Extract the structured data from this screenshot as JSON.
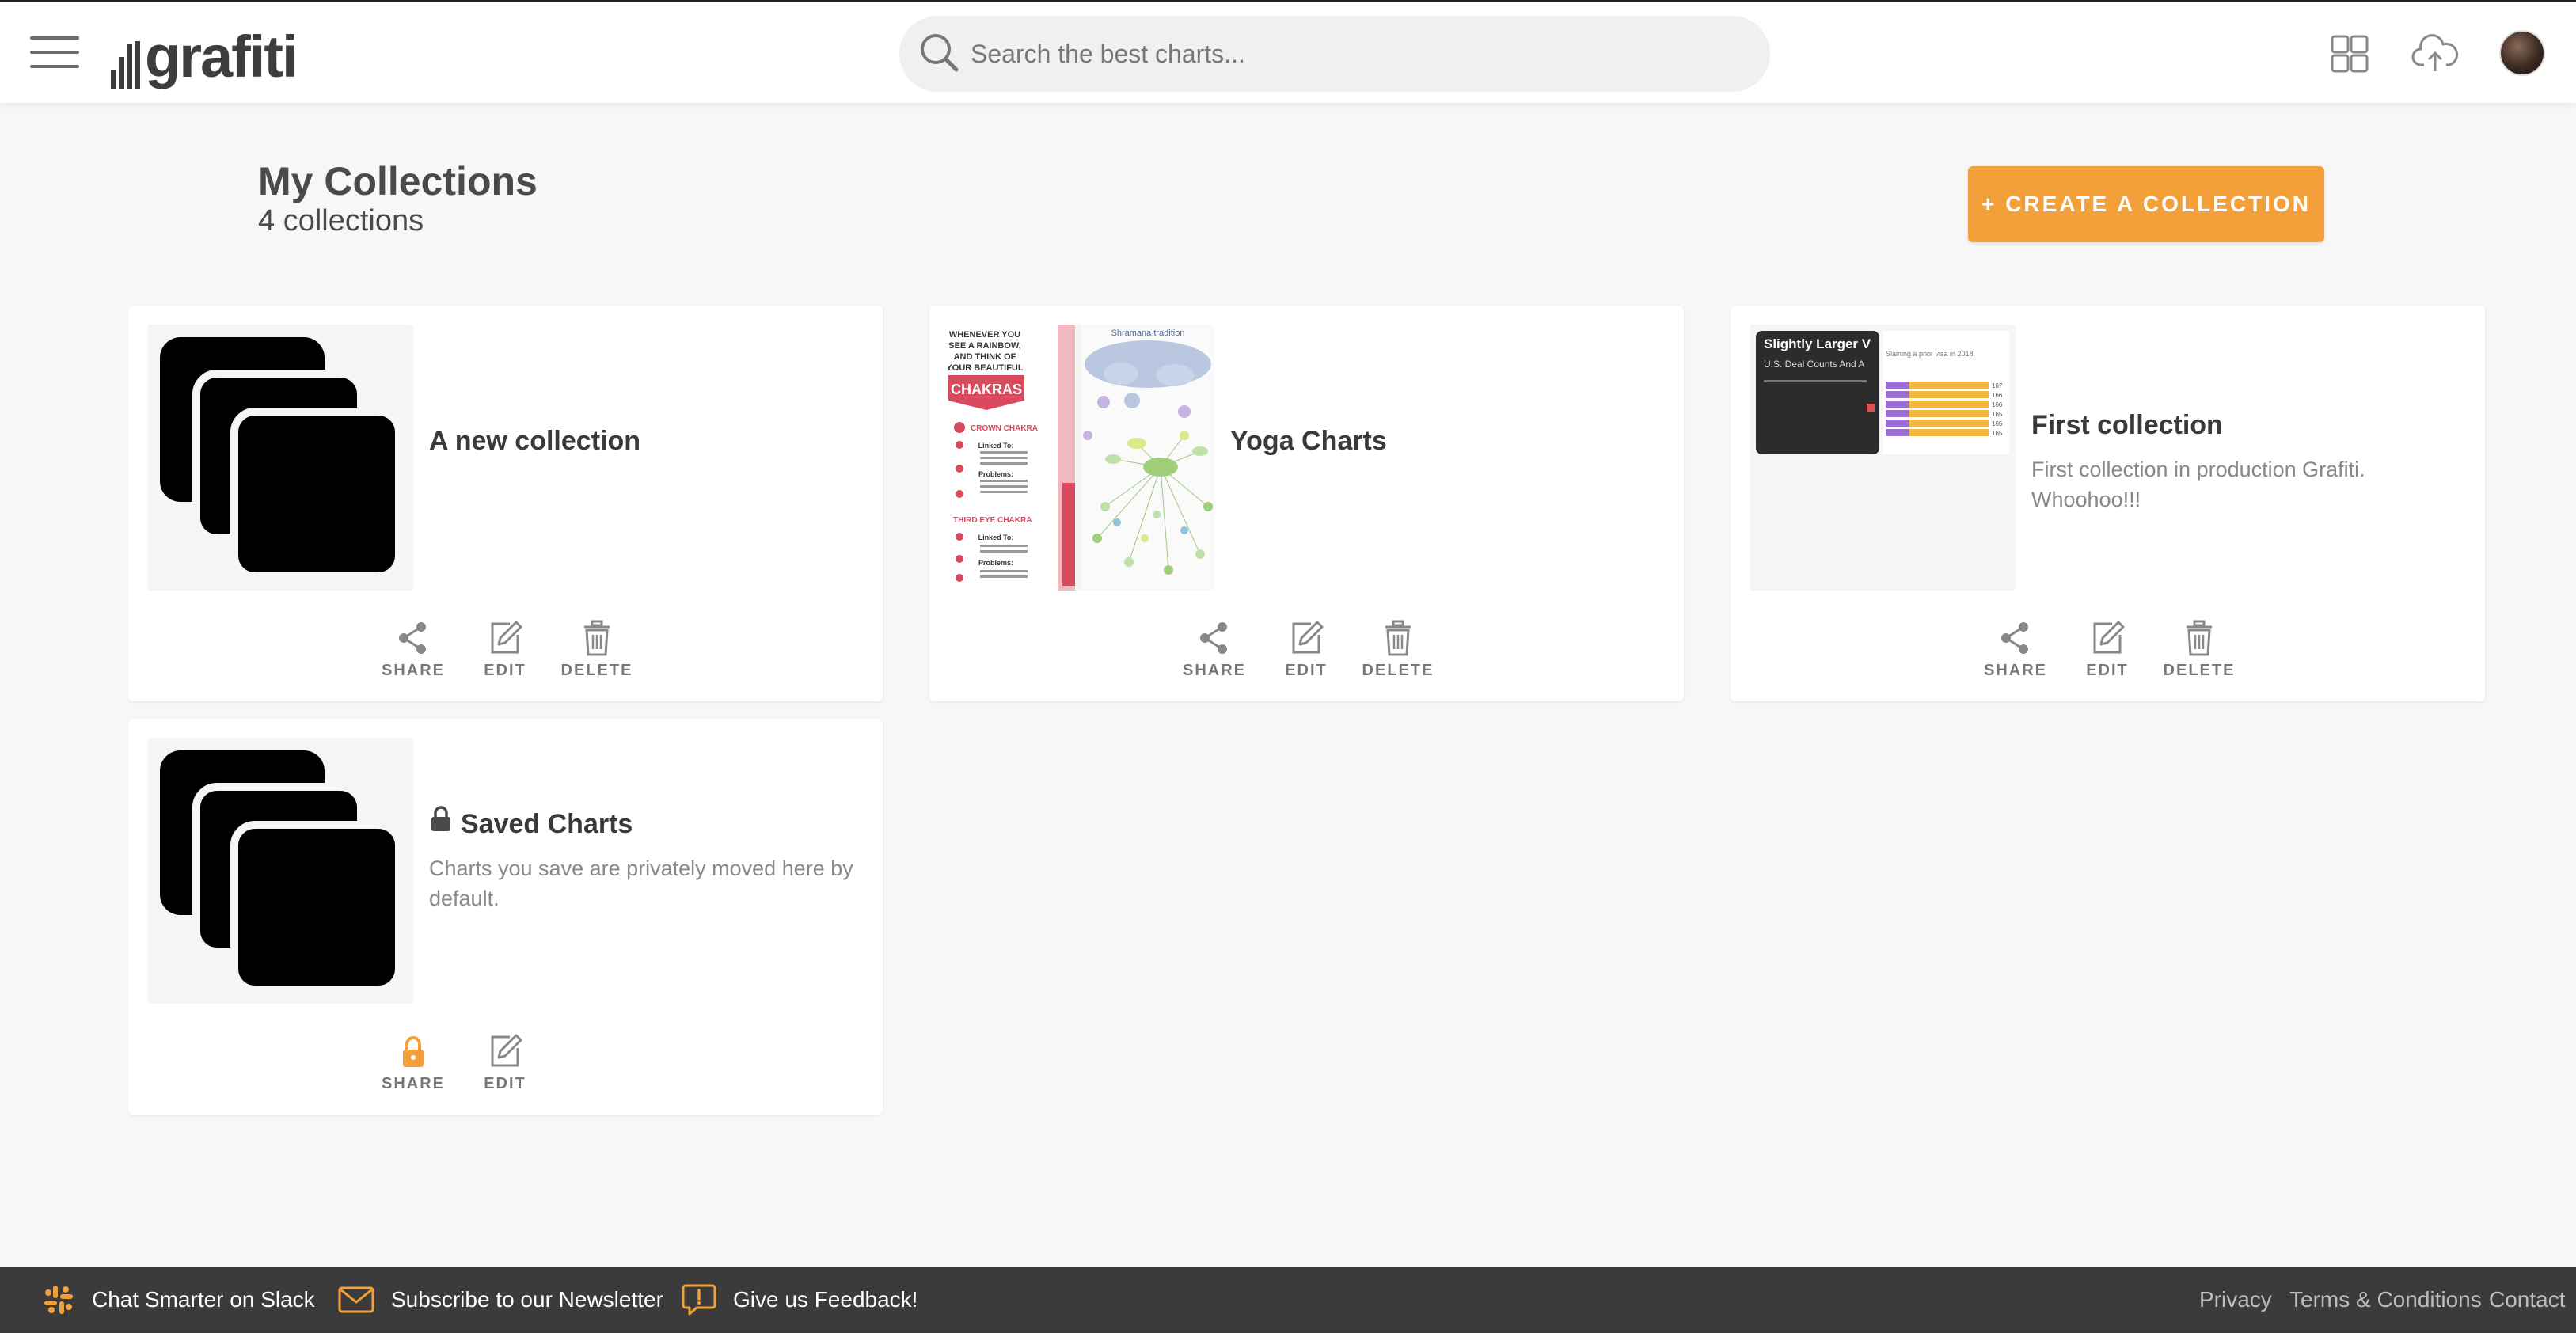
{
  "header": {
    "logo_text": "grafiti",
    "search_placeholder": "Search the best charts..."
  },
  "page": {
    "title": "My Collections",
    "subtitle": "4 collections",
    "create_button": "+ CREATE A COLLECTION"
  },
  "actions": {
    "share": "SHARE",
    "edit": "EDIT",
    "delete": "DELETE"
  },
  "collections": [
    {
      "title": "A new collection",
      "description": ""
    },
    {
      "title": "Yoga Charts",
      "description": ""
    },
    {
      "title": "First collection",
      "description": "First collection in production Grafiti. Whoohoo!!!"
    },
    {
      "title": "Saved Charts",
      "description": "Charts you save are privately moved here by default."
    }
  ],
  "thumbnails": {
    "yoga_left_lines": [
      "WHENEVER YOU",
      "SEE A RAINBOW,",
      "AND THINK OF",
      "YOUR BEAUTIFUL",
      "CHAKRAS",
      "CROWN CHAKRA",
      "Linked To:",
      "Problems:",
      "THIRD EYE CHAKRA",
      "Linked To:",
      "Problems:"
    ],
    "yoga_right_title": "Shramana tradition",
    "first_left_title": "Slightly Larger V",
    "first_left_sub": "U.S. Deal Counts And A",
    "first_right_title": "Slaining a prior visa in 2018",
    "first_right_values": [
      "167",
      "166",
      "166",
      "165",
      "165",
      "165"
    ]
  },
  "footer": {
    "slack": "Chat Smarter on Slack",
    "newsletter": "Subscribe to our Newsletter",
    "feedback": "Give us Feedback!",
    "privacy": "Privacy",
    "terms": "Terms & Conditions",
    "contact": "Contact"
  },
  "colors": {
    "accent": "#f4a03a",
    "footer_bg": "#3b3b3b",
    "page_bg": "#f7f7f7"
  }
}
